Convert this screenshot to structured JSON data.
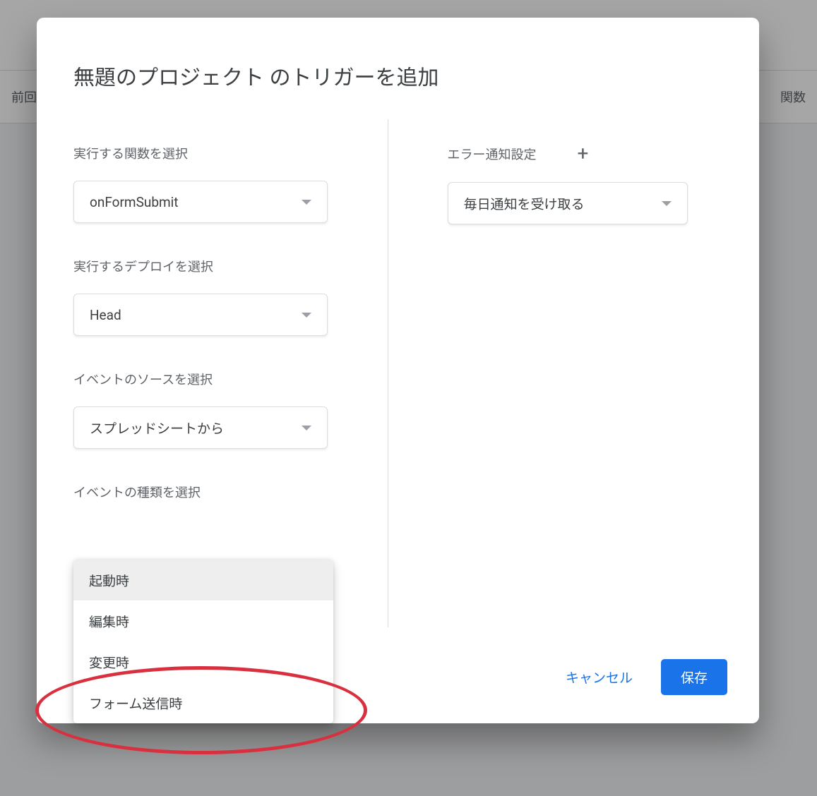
{
  "background": {
    "left_text": "前回の",
    "right_text": "関数"
  },
  "modal": {
    "title": "無題のプロジェクト のトリガーを追加",
    "left": {
      "function": {
        "label": "実行する関数を選択",
        "value": "onFormSubmit"
      },
      "deploy": {
        "label": "実行するデプロイを選択",
        "value": "Head"
      },
      "source": {
        "label": "イベントのソースを選択",
        "value": "スプレッドシートから"
      },
      "event_type": {
        "label": "イベントの種類を選択",
        "options": [
          "起動時",
          "編集時",
          "変更時",
          "フォーム送信時"
        ]
      }
    },
    "right": {
      "error_notify": {
        "label": "エラー通知設定",
        "value": "毎日通知を受け取る"
      }
    },
    "footer": {
      "cancel": "キャンセル",
      "save": "保存"
    }
  }
}
